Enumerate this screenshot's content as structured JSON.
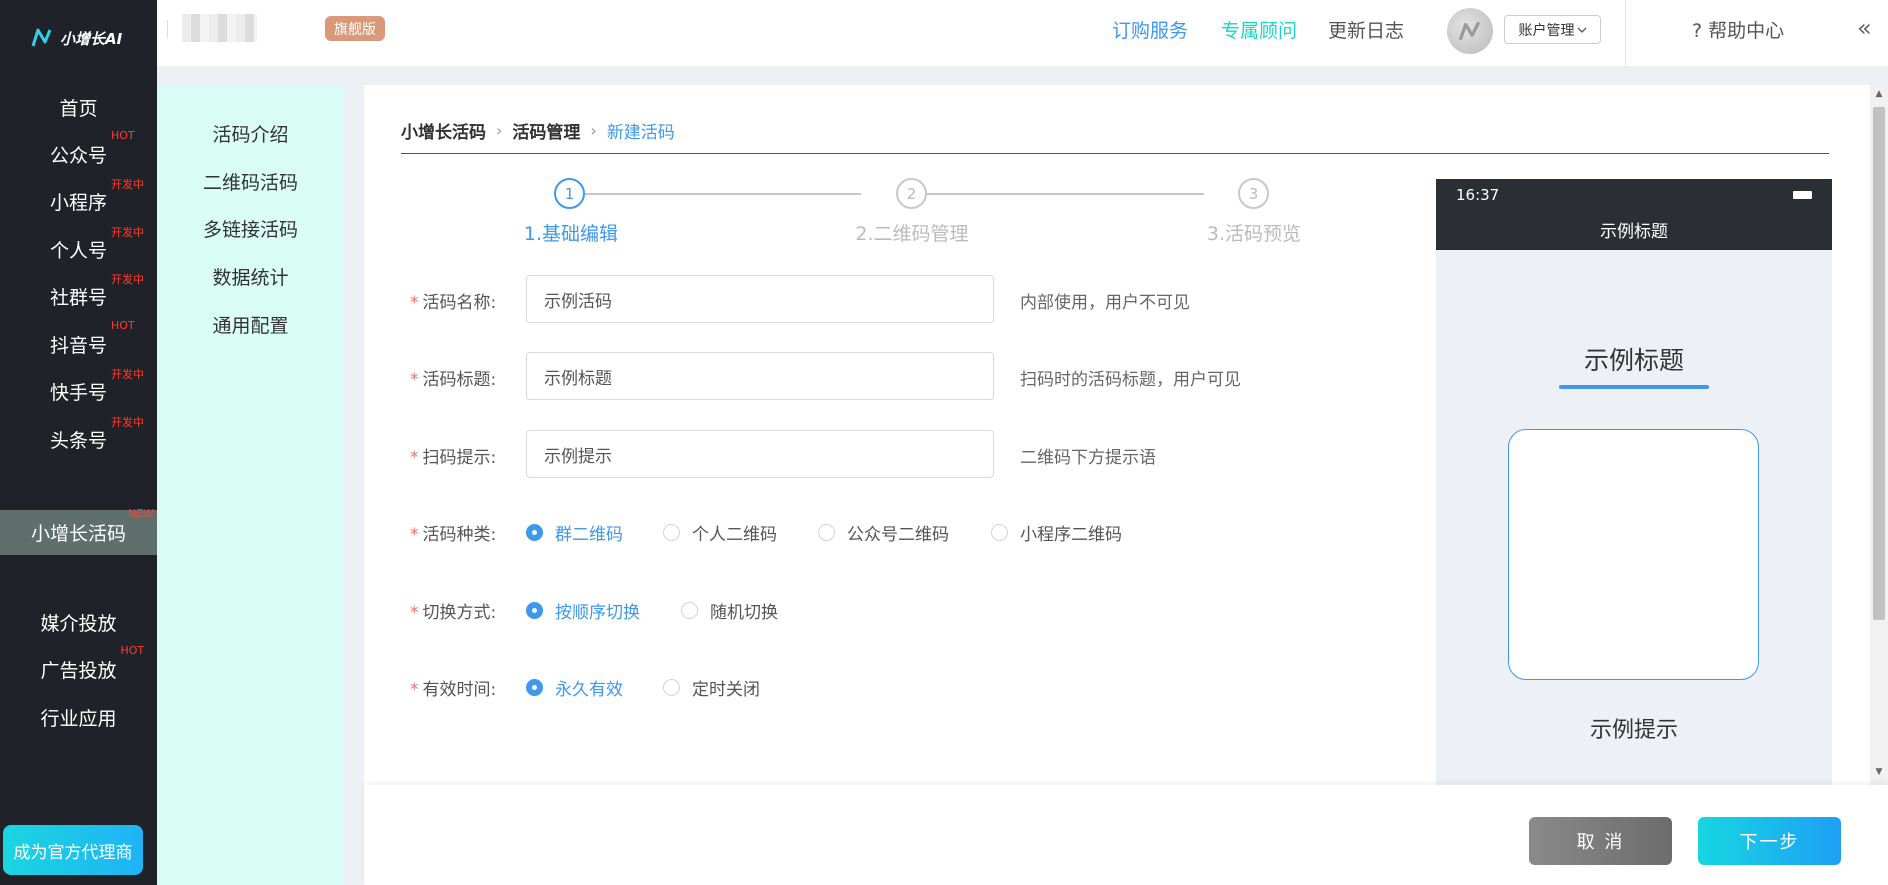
{
  "logo": {
    "text": "小增长AI"
  },
  "sidebar": {
    "items": [
      {
        "label": "首页",
        "badge": ""
      },
      {
        "label": "公众号",
        "badge": "HOT"
      },
      {
        "label": "小程序",
        "badge": "开发中"
      },
      {
        "label": "个人号",
        "badge": "开发中"
      },
      {
        "label": "社群号",
        "badge": "开发中"
      },
      {
        "label": "抖音号",
        "badge": "HOT"
      },
      {
        "label": "快手号",
        "badge": "开发中"
      },
      {
        "label": "头条号",
        "badge": "开发中"
      },
      {
        "label": "小增长活码",
        "badge": "NEW"
      },
      {
        "label": "媒介投放",
        "badge": ""
      },
      {
        "label": "广告投放",
        "badge": "HOT"
      },
      {
        "label": "行业应用",
        "badge": ""
      }
    ],
    "agent_button": "成为官方代理商"
  },
  "header": {
    "edition_tag": "旗舰版",
    "subscribe": "订购服务",
    "advisor": "专属顾问",
    "changelog": "更新日志",
    "account": "账户管理",
    "help": "帮助中心",
    "collapse": "«"
  },
  "subnav": {
    "items": [
      "活码介绍",
      "二维码活码",
      "多链接活码",
      "数据统计",
      "通用配置"
    ]
  },
  "breadcrumb": {
    "root": "小增长活码",
    "parent": "活码管理",
    "current": "新建活码"
  },
  "steps": [
    {
      "num": "1",
      "label": "1.基础编辑"
    },
    {
      "num": "2",
      "label": "2.二维码管理"
    },
    {
      "num": "3",
      "label": "3.活码预览"
    }
  ],
  "form": {
    "name": {
      "label": "活码名称:",
      "value": "示例活码",
      "hint": "内部使用，用户不可见"
    },
    "title": {
      "label": "活码标题:",
      "value": "示例标题",
      "hint": "扫码时的活码标题，用户可见"
    },
    "tip": {
      "label": "扫码提示:",
      "value": "示例提示",
      "hint": "二维码下方提示语"
    },
    "type": {
      "label": "活码种类:",
      "options": [
        "群二维码",
        "个人二维码",
        "公众号二维码",
        "小程序二维码"
      ],
      "selected": "群二维码"
    },
    "switch": {
      "label": "切换方式:",
      "options": [
        "按顺序切换",
        "随机切换"
      ],
      "selected": "按顺序切换"
    },
    "validity": {
      "label": "有效时间:",
      "options": [
        "永久有效",
        "定时关闭"
      ],
      "selected": "永久有效"
    }
  },
  "preview": {
    "time": "16:37",
    "nav_title": "示例标题",
    "heading": "示例标题",
    "tip": "示例提示"
  },
  "footer": {
    "cancel": "取 消",
    "next": "下一步"
  },
  "colors": {
    "accent": "#3f98ef",
    "cyan": "#18d6e2",
    "sidebar": "#1f2228",
    "subnav": "#d9fdf5",
    "hot": "#ff3b30"
  }
}
